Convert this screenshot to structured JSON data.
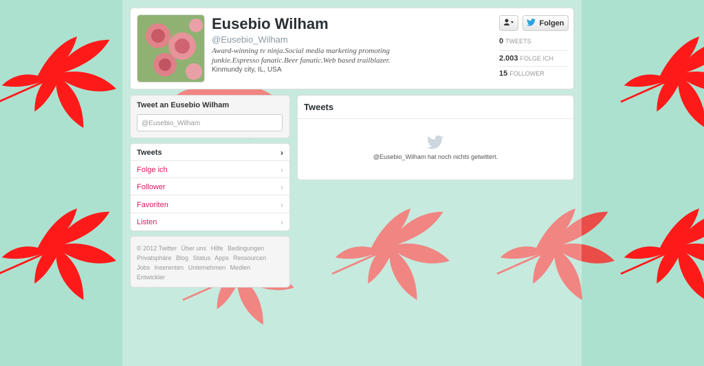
{
  "profile": {
    "name": "Eusebio Wilham",
    "handle": "@Eusebio_Wilham",
    "bio": "Award-winning tv ninja.Social media marketing promoting junkie.Espresso fanatic.Beer fanatic.Web based trailblazer.",
    "location": "Kinmundy city, IL, USA",
    "follow_label": "Folgen",
    "stats": [
      {
        "value": "0",
        "label": "TWEETS"
      },
      {
        "value": "2.003",
        "label": "FOLGE ICH"
      },
      {
        "value": "15",
        "label": "FOLLOWER"
      }
    ]
  },
  "tweet_to": {
    "title": "Tweet an Eusebio Wilham",
    "placeholder": "@Eusebio_Wilham"
  },
  "nav": [
    {
      "label": "Tweets"
    },
    {
      "label": "Folge ich"
    },
    {
      "label": "Follower"
    },
    {
      "label": "Favoriten"
    },
    {
      "label": "Listen"
    }
  ],
  "footer": {
    "links": [
      "© 2012 Twitter",
      "Über uns",
      "Hilfe",
      "Bedingungen",
      "Privatsphäre",
      "Blog",
      "Status",
      "Apps",
      "Ressourcen",
      "Jobs",
      "Inserenten",
      "Unternehmen",
      "Medien",
      "Entwickler"
    ]
  },
  "tweets_panel": {
    "title": "Tweets",
    "empty_message": "@Eusebio_Wilham hat noch nichts getwittert."
  },
  "colors": {
    "background": "#ade1cf",
    "leaf_red": "#ff1a1a",
    "link_pink": "#d81a60",
    "twitter_blue": "#2ca3dd"
  }
}
